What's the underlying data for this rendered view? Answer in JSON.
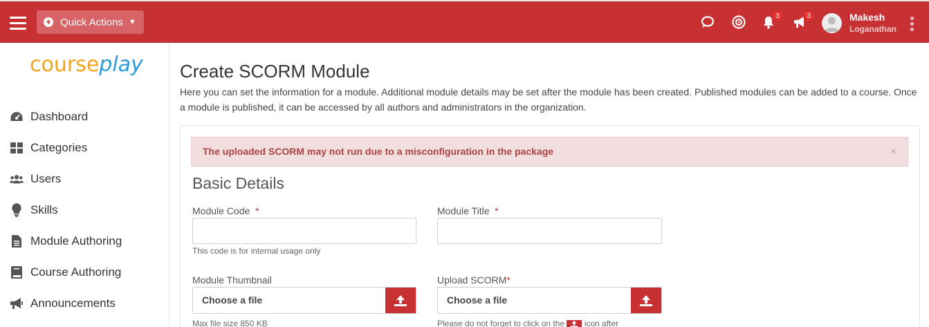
{
  "topbar": {
    "quick_actions_label": "Quick Actions",
    "notifications_count": "3",
    "announcements_count": "3",
    "user_first_name": "Makesh",
    "user_last_name": "Loganathan"
  },
  "sidebar": {
    "logo_part1": "course",
    "logo_part2": "play",
    "items": [
      {
        "label": "Dashboard",
        "icon": "dashboard-icon"
      },
      {
        "label": "Categories",
        "icon": "grid-icon"
      },
      {
        "label": "Users",
        "icon": "users-icon"
      },
      {
        "label": "Skills",
        "icon": "lightbulb-icon"
      },
      {
        "label": "Module Authoring",
        "icon": "document-icon"
      },
      {
        "label": "Course Authoring",
        "icon": "book-icon"
      },
      {
        "label": "Announcements",
        "icon": "megaphone-icon"
      }
    ]
  },
  "main": {
    "title": "Create SCORM Module",
    "description": "Here you can set the information for a module. Additional module details may be set after the module has been created. Published modules can be added to a course. Once a module is published, it can be accessed by all authors and administrators in the organization.",
    "alert": "The uploaded SCORM may not run due to a misconfiguration in the package",
    "alert_close": "×",
    "section_title": "Basic Details",
    "module_code_label": "Module Code",
    "module_code_help": "This code is for internal usage only",
    "module_title_label": "Module Title",
    "thumbnail_label": "Module Thumbnail",
    "thumbnail_choose": "Choose a file",
    "thumbnail_help": "Max file size 850 KB",
    "upload_scorm_label": "Upload SCORM",
    "upload_choose": "Choose a file",
    "upload_help_prefix": "Please do not forget to click on the",
    "upload_help_suffix": "icon after",
    "required_mark": "*"
  },
  "colors": {
    "brand_red": "#c83134",
    "alert_bg": "#f2dede",
    "alert_text": "#a94442"
  }
}
